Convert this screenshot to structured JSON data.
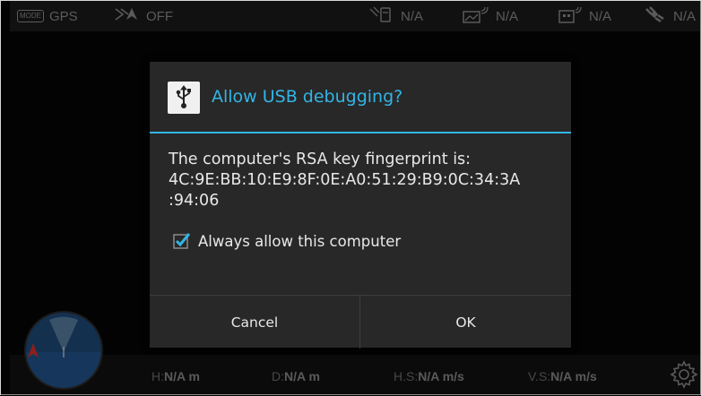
{
  "status_bar": {
    "mode_label": "MODE",
    "mode_value": "GPS",
    "takeoff_value": "OFF",
    "signal_1": "N/A",
    "signal_2": "N/A",
    "signal_3": "N/A",
    "gps_sat": "N/A"
  },
  "dialog": {
    "title": "Allow USB debugging?",
    "message_line1": "The computer's RSA key fingerprint is:",
    "message_line2": "4C:9E:BB:10:E9:8F:0E:A0:51:29:B9:0C:34:3A",
    "message_line3": ":94:06",
    "checkbox_label": "Always allow this computer",
    "checkbox_checked": true,
    "cancel_label": "Cancel",
    "ok_label": "OK",
    "accent_color": "#33b5e5",
    "icon": "usb-icon"
  },
  "telemetry": {
    "h_label": "H:",
    "h_value": "N/A m",
    "d_label": "D:",
    "d_value": "N/A m",
    "hs_label": "H.S:",
    "hs_value": "N/A m/s",
    "vs_label": "V.S:",
    "vs_value": "N/A m/s"
  }
}
